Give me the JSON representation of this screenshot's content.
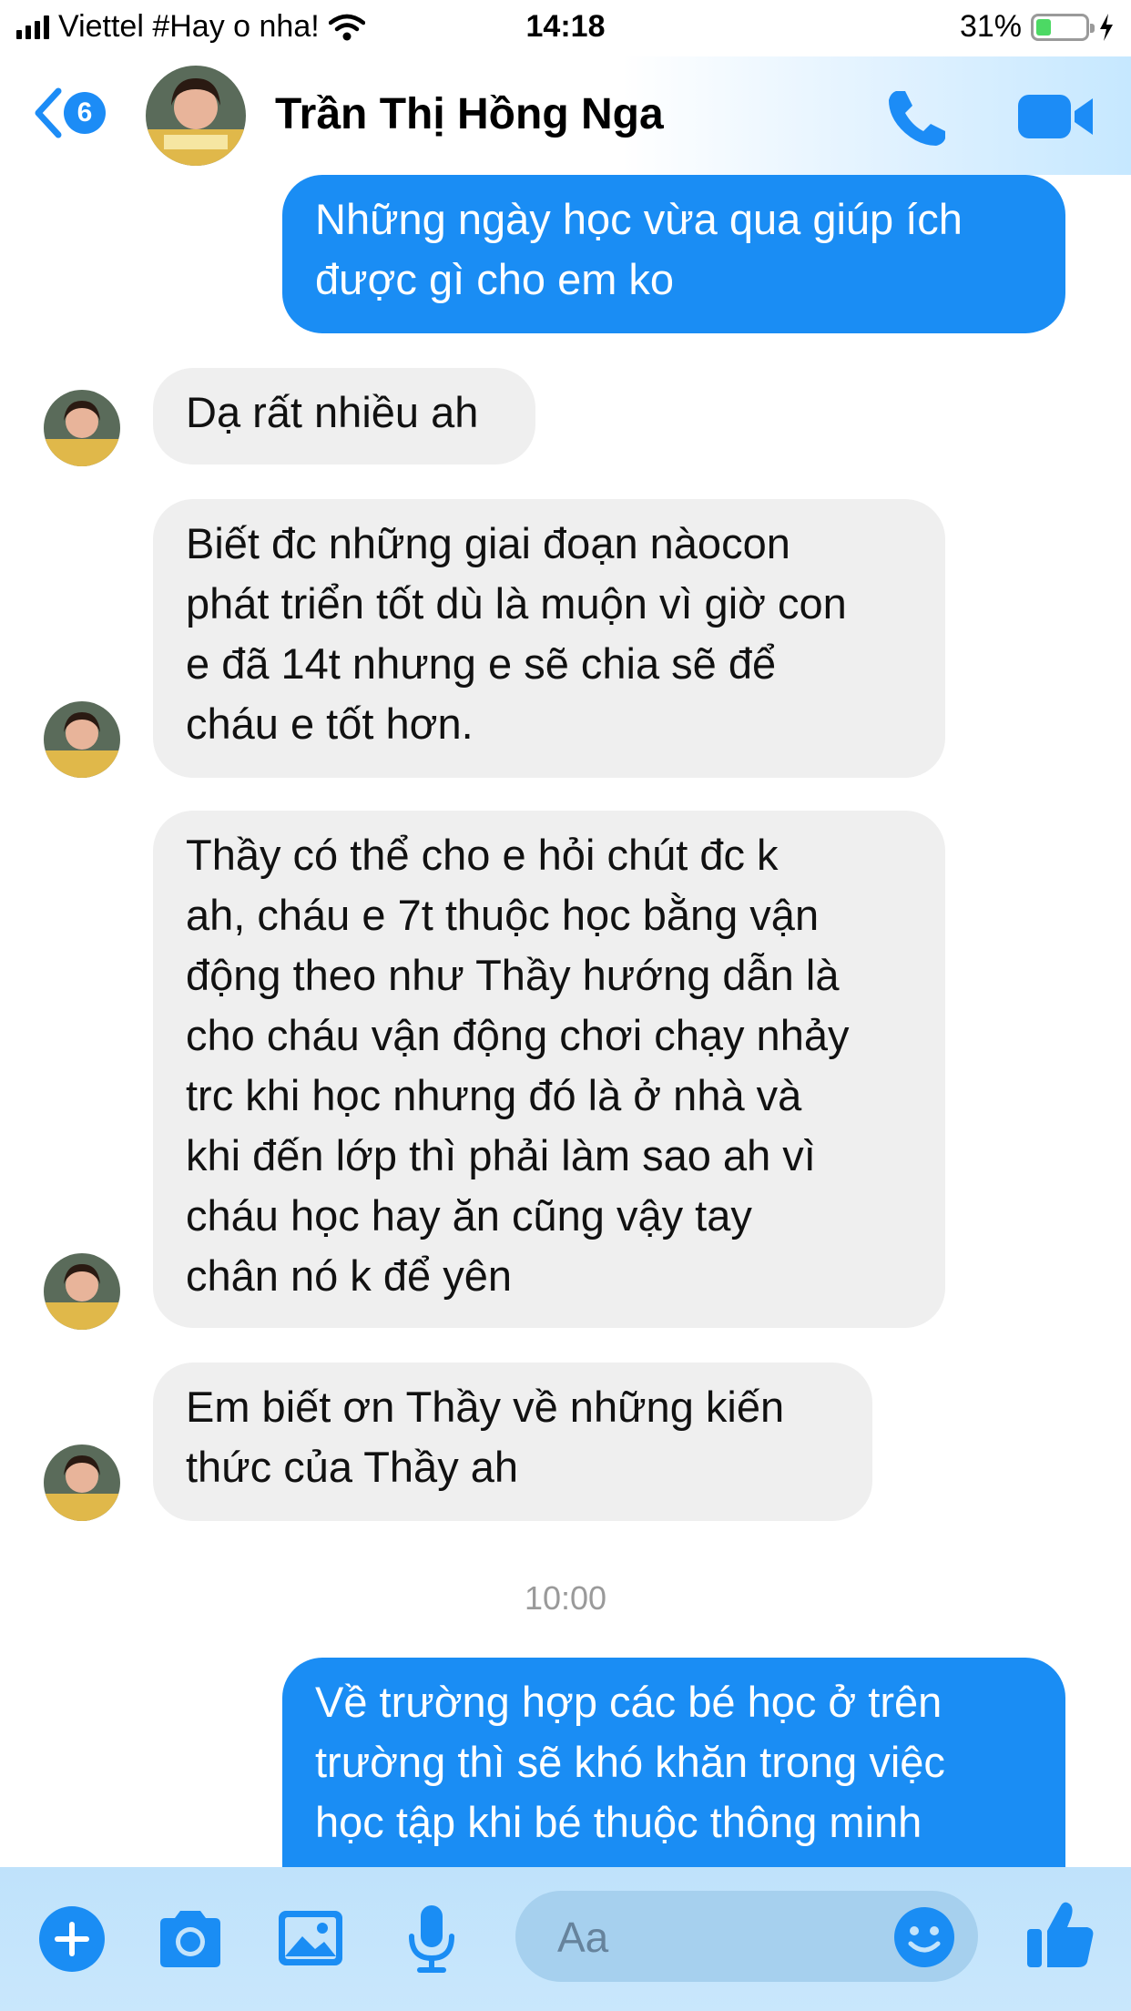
{
  "status_bar": {
    "carrier": "Viettel #Hay o nha!",
    "time": "14:18",
    "battery": "31%",
    "battery_level": 0.31
  },
  "header": {
    "back_count": "6",
    "contact_name": "Trần Thị Hồng Nga",
    "call_icon": "phone-icon",
    "video_icon": "video-camera-icon"
  },
  "messages": [
    {
      "from": "me",
      "text": "Những ngày học vừa qua giúp ích\nđược gì cho em ko"
    },
    {
      "from": "contact",
      "text": "Dạ rất nhiều ah"
    },
    {
      "from": "contact",
      "text": "Biết đc những giai đoạn nàocon\nphát triển tốt dù là muộn vì giờ con\ne đã 14t nhưng e sẽ chia sẽ để\ncháu e tốt hơn."
    },
    {
      "from": "contact",
      "text": "Thầy có thể cho e hỏi chút đc k\nah, cháu e 7t thuộc học bằng vận\nđộng theo như Thầy hướng dẫn là\ncho cháu vận động chơi chạy nhảy\ntrc khi học nhưng đó là ở nhà và\nkhi đến lớp thì phải làm sao ah vì\ncháu học hay ăn cũng vậy tay\nchân nó k để yên"
    },
    {
      "from": "contact",
      "text": "Em biết ơn Thầy về những kiến\nthức của Thầy ah"
    },
    {
      "from": "me",
      "text": "Về trường hợp các bé học ở trên\ntrường thì  sẽ khó khăn trong việc\nhọc tập khi bé thuộc thông minh"
    }
  ],
  "timestamp": "10:00",
  "composer": {
    "placeholder": "Aa"
  },
  "colors": {
    "accent": "#1a8df4",
    "incoming_bubble": "#efefef",
    "timestamp": "#9a9a9a"
  }
}
